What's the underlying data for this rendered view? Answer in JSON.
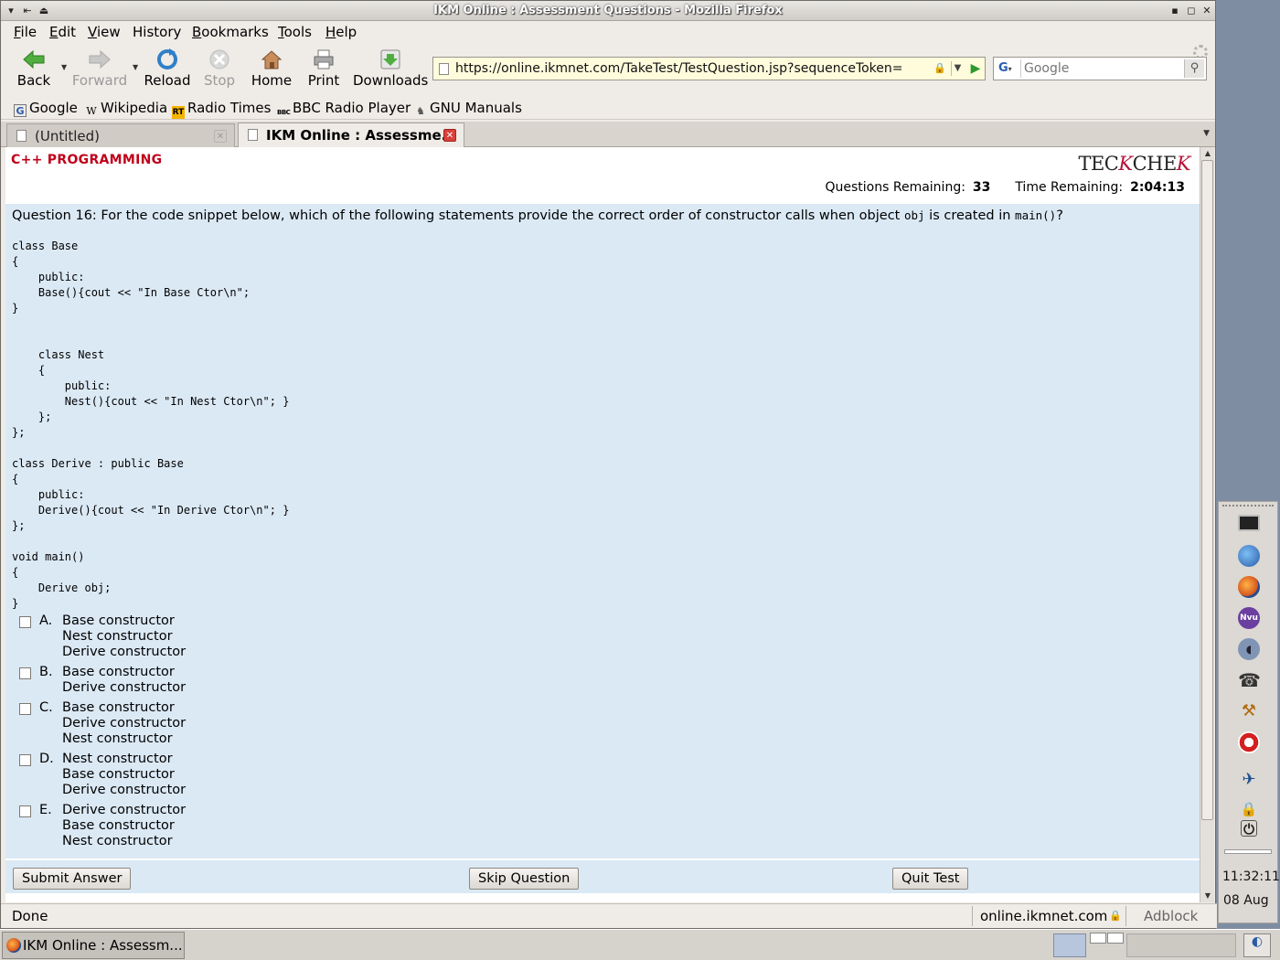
{
  "window": {
    "title": "IKM Online : Assessment Questions - Mozilla Firefox"
  },
  "menubar": {
    "items": [
      {
        "label": "File",
        "ul": "F",
        "rest": "ile"
      },
      {
        "label": "Edit",
        "ul": "E",
        "rest": "dit"
      },
      {
        "label": "View",
        "ul": "V",
        "rest": "iew"
      },
      {
        "label": "History",
        "ul": "",
        "rest": "History"
      },
      {
        "label": "Bookmarks",
        "ul": "B",
        "rest": "ookmarks"
      },
      {
        "label": "Tools",
        "ul": "T",
        "rest": "ools"
      },
      {
        "label": "Help",
        "ul": "H",
        "rest": "elp"
      }
    ]
  },
  "navbar": {
    "back": "Back",
    "forward": "Forward",
    "reload": "Reload",
    "stop": "Stop",
    "home": "Home",
    "print": "Print",
    "downloads": "Downloads",
    "url": "https://online.ikmnet.com/TakeTest/TestQuestion.jsp?sequenceToken=",
    "search_placeholder": "Google",
    "search_engine": "G"
  },
  "bookmarks": [
    {
      "label": "Google",
      "icon": "google-icon"
    },
    {
      "label": "Wikipedia",
      "icon": "wikipedia-icon"
    },
    {
      "label": "Radio Times",
      "icon": "radio-times-icon"
    },
    {
      "label": "BBC Radio Player",
      "icon": "bbc-icon"
    },
    {
      "label": "GNU Manuals",
      "icon": "gnu-icon"
    }
  ],
  "tabs": [
    {
      "label": "(Untitled)",
      "active": false
    },
    {
      "label": "IKM Online : Assessme...",
      "active": true
    }
  ],
  "page": {
    "course": "C++ PROGRAMMING",
    "logo_pre": "TEC",
    "logo_k": "K",
    "logo_mid": "CHE",
    "logo_k2": "K",
    "questions_remaining_label": "Questions Remaining:",
    "questions_remaining_value": "33",
    "time_remaining_label": "Time Remaining:",
    "time_remaining_value": "2:04:13",
    "question_prefix": "Question 16: For the code snippet below, which of the following statements provide the correct order of constructor calls when object",
    "question_obj": "obj",
    "question_mid": "is created in",
    "question_main": "main()",
    "question_end": "?",
    "code": "class Base\n{\n    public:\n    Base(){cout << \"In Base Ctor\\n\";\n}\n\n\n    class Nest\n    {\n        public:\n        Nest(){cout << \"In Nest Ctor\\n\"; }\n    };\n};\n\nclass Derive : public Base\n{\n    public:\n    Derive(){cout << \"In Derive Ctor\\n\"; }\n};\n\nvoid main()\n{\n    Derive obj;\n}",
    "options": [
      {
        "letter": "A.",
        "lines": [
          "Base constructor",
          "Nest constructor",
          "Derive constructor"
        ]
      },
      {
        "letter": "B.",
        "lines": [
          "Base constructor",
          "Derive constructor"
        ]
      },
      {
        "letter": "C.",
        "lines": [
          "Base constructor",
          "Derive constructor",
          "Nest constructor"
        ]
      },
      {
        "letter": "D.",
        "lines": [
          "Nest constructor",
          "Base constructor",
          "Derive constructor"
        ]
      },
      {
        "letter": "E.",
        "lines": [
          "Derive constructor",
          "Base constructor",
          "Nest constructor"
        ]
      }
    ],
    "submit": "Submit Answer",
    "skip": "Skip Question",
    "quit": "Quit Test"
  },
  "status": {
    "text": "Done",
    "domain": "online.ikmnet.com",
    "adblock": "Adblock"
  },
  "taskbar": {
    "window_label": "IKM Online : Assessm..."
  },
  "dock": {
    "clock": "11:32:11",
    "date": "08 Aug"
  }
}
